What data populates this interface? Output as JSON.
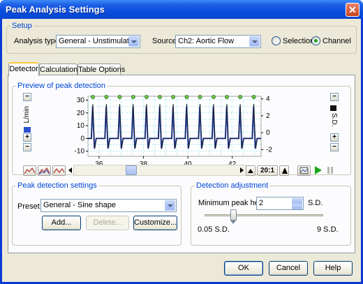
{
  "window": {
    "title": "Peak Analysis Settings",
    "close_glyph": "✕"
  },
  "setup": {
    "legend": "Setup",
    "analysis_type_label": "Analysis type:",
    "analysis_type_value": "General - Unstimulated",
    "source_label": "Source:",
    "source_value": "Ch2: Aortic Flow",
    "radio_selection": "Selection",
    "radio_channel": "Channel",
    "selected_radio": "Channel"
  },
  "tabs": [
    {
      "label": "Detector",
      "active": true
    },
    {
      "label": "Calculations",
      "active": false
    },
    {
      "label": "Table Options",
      "active": false
    }
  ],
  "preview": {
    "legend": "Preview of peak detection",
    "left_axis_label": "L/min",
    "right_axis_label": "S.D.",
    "zoom_ratio": "20:1",
    "minus": "−",
    "plus": "+"
  },
  "chart_data": {
    "type": "line",
    "x_ticks": [
      36,
      38,
      40,
      42
    ],
    "left_y_ticks": [
      30,
      20,
      10,
      0,
      -10
    ],
    "right_y_ticks": [
      4,
      2,
      0,
      -2
    ],
    "ylim_left": [
      -14,
      33
    ],
    "ylim_right": [
      -2.8,
      4.3
    ],
    "xlim": [
      35.5,
      43.3
    ],
    "peak_times": [
      35.72,
      36.33,
      36.93,
      37.54,
      38.14,
      38.74,
      39.34,
      39.95,
      40.55,
      41.16,
      41.76,
      42.36,
      42.97
    ],
    "series": [
      {
        "color": "#1a1a1a",
        "peak_value": 27
      },
      {
        "color": "#2a4fd0",
        "peak_value": 25
      }
    ],
    "marker_color": "#6cc04a",
    "grid": true
  },
  "peak_settings": {
    "legend": "Peak detection settings",
    "preset_label": "Preset:",
    "preset_value": "General - Sine shape",
    "add_button": "Add...",
    "delete_button": "Delete...",
    "customize_button": "Customize..."
  },
  "adjustment": {
    "legend": "Detection adjustment",
    "min_height_label": "Minimum peak height:",
    "min_height_value": "2",
    "unit": "S.D.",
    "slider_min": "0.05 S.D.",
    "slider_max": "9 S.D."
  },
  "footer": {
    "ok": "OK",
    "cancel": "Cancel",
    "help": "Help"
  }
}
